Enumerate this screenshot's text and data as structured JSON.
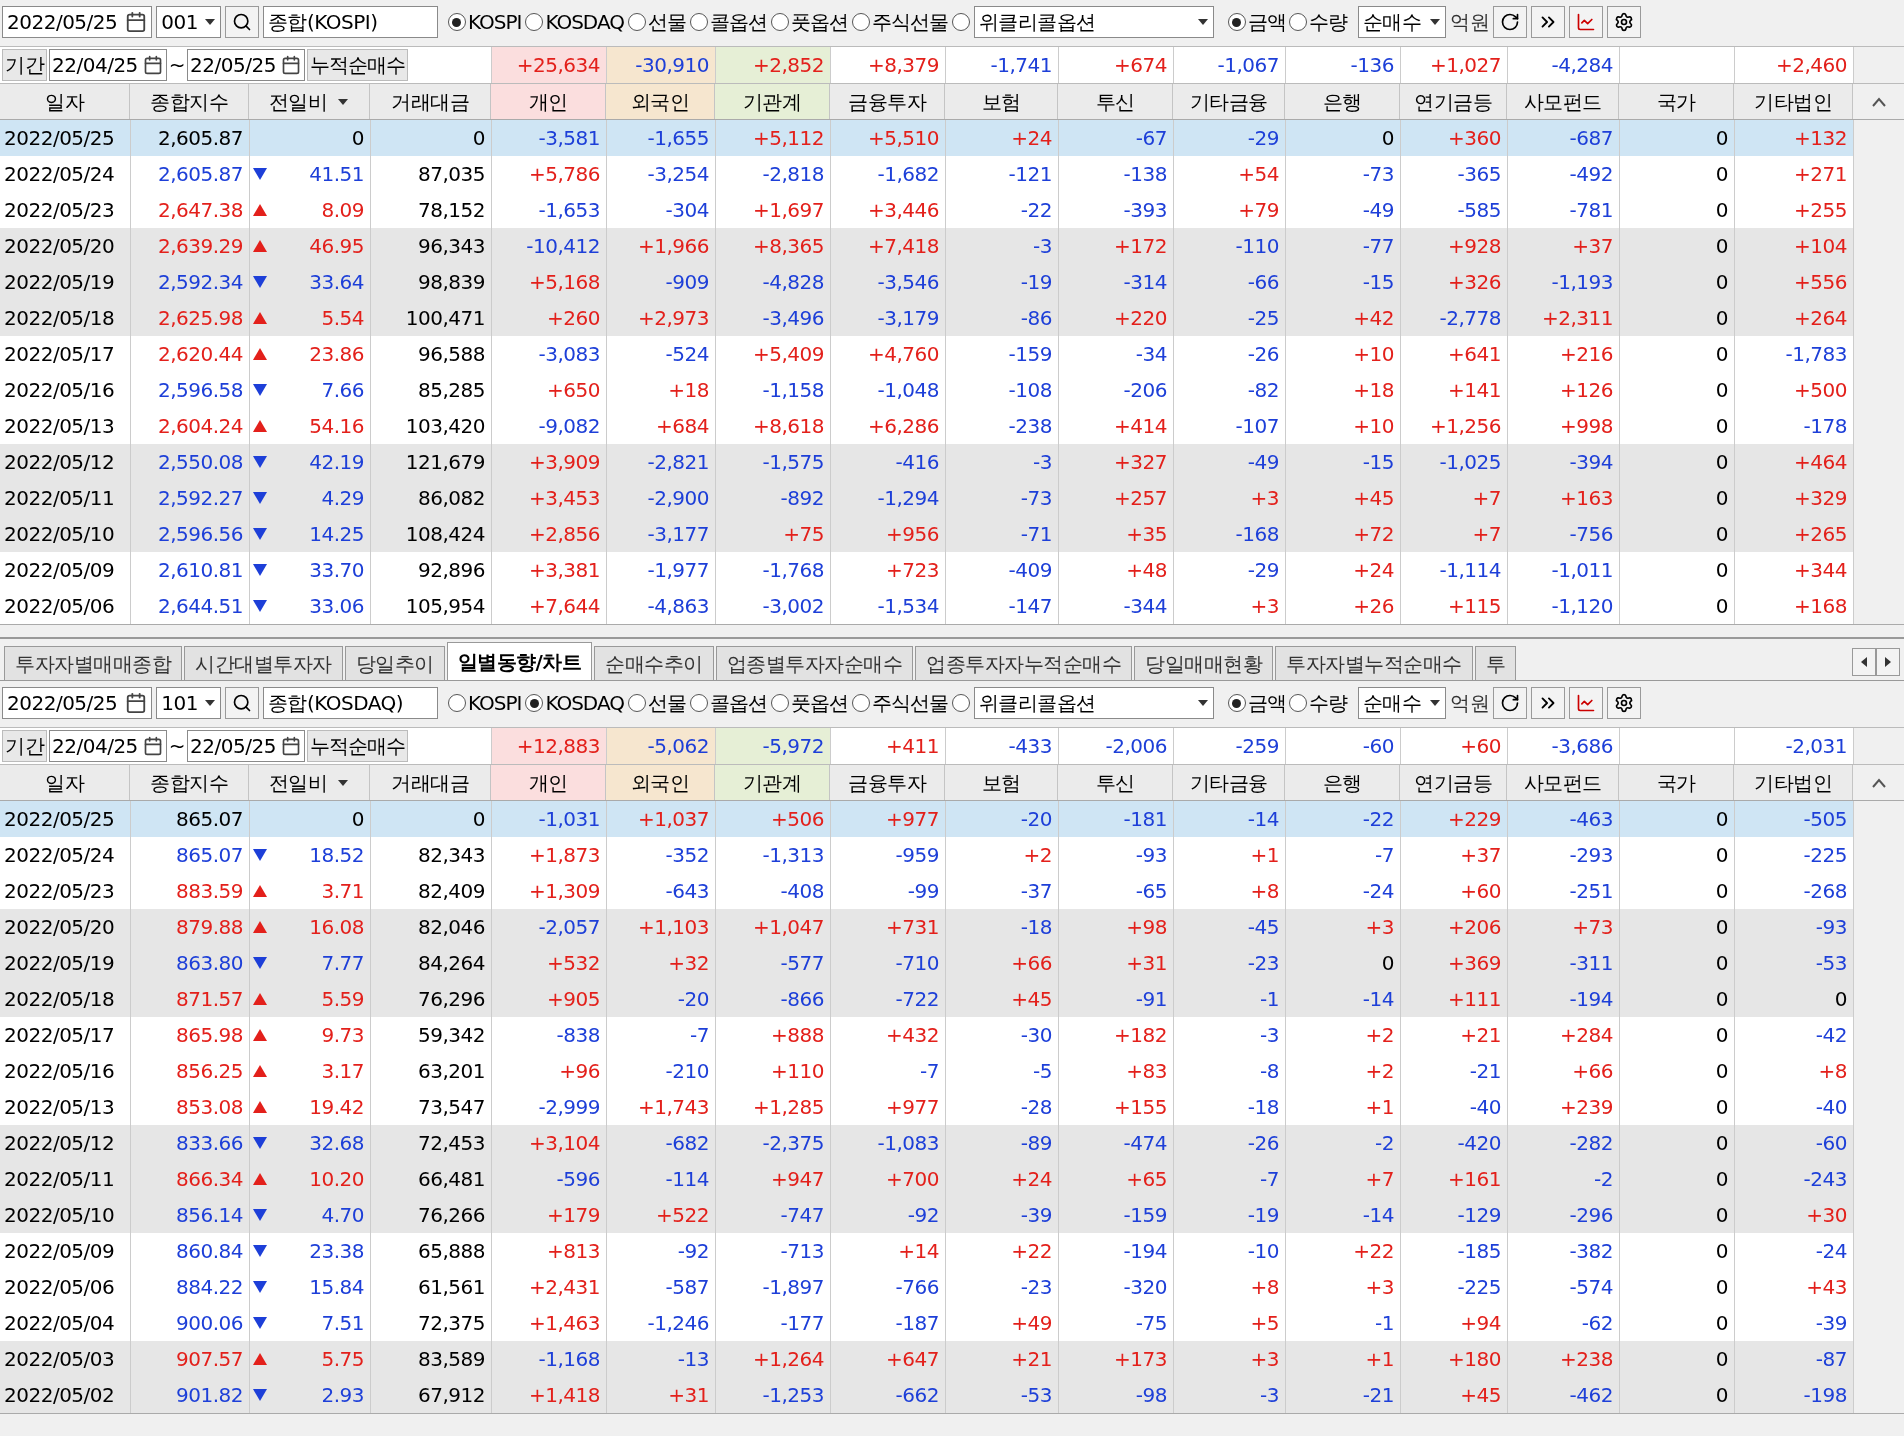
{
  "panels": [
    {
      "toolbar": {
        "date": "2022/05/25",
        "code": "001",
        "name": "종합(KOSPI)",
        "markets": [
          {
            "label": "KOSPI",
            "selected": true,
            "kind": "radio"
          },
          {
            "label": "KOSDAQ",
            "selected": false,
            "kind": "radio"
          },
          {
            "label": "선물",
            "selected": false,
            "kind": "radio"
          },
          {
            "label": "콜옵션",
            "selected": false,
            "kind": "radio"
          },
          {
            "label": "풋옵션",
            "selected": false,
            "kind": "radio"
          },
          {
            "label": "주식선물",
            "selected": false,
            "kind": "radio"
          },
          {
            "label": "위클리콜옵션",
            "selected": false,
            "kind": "dropdown"
          }
        ],
        "units": [
          {
            "label": "금액",
            "selected": true
          },
          {
            "label": "수량",
            "selected": false
          }
        ],
        "mode": "순매수",
        "unit_label": "억원"
      },
      "summary": {
        "label": "기간",
        "from": "22/04/25",
        "sep": "~",
        "to": "22/05/25",
        "title": "누적순매수",
        "values": [
          "+25,634",
          "-30,910",
          "+2,852",
          "+8,379",
          "-1,741",
          "+674",
          "-1,067",
          "-136",
          "+1,027",
          "-4,284",
          "+2,460"
        ]
      },
      "columns": [
        {
          "label": "일자",
          "menu": false
        },
        {
          "label": "종합지수",
          "menu": false
        },
        {
          "label": "전일비",
          "menu": true
        },
        {
          "label": "거래대금",
          "menu": false
        },
        {
          "label": "개인",
          "menu": false
        },
        {
          "label": "외국인",
          "menu": false
        },
        {
          "label": "기관계",
          "menu": false
        },
        {
          "label": "금융투자",
          "menu": false
        },
        {
          "label": "보험",
          "menu": false
        },
        {
          "label": "투신",
          "menu": false
        },
        {
          "label": "기타금융",
          "menu": false
        },
        {
          "label": "은행",
          "menu": false
        },
        {
          "label": "연기금등",
          "menu": false
        },
        {
          "label": "사모펀드",
          "menu": false
        },
        {
          "label": "국가",
          "menu": false
        },
        {
          "label": "기타법인",
          "menu": false
        }
      ],
      "rows": [
        {
          "date": "2022/05/25",
          "index": "2,605.87",
          "kind": "flat",
          "change": "0",
          "volume": "0",
          "values": [
            "-3,581",
            "-1,655",
            "+5,112",
            "+5,510",
            "+24",
            "-67",
            "-29",
            "0",
            "+360",
            "-687",
            "0",
            "+132"
          ],
          "selected": true
        },
        {
          "date": "2022/05/24",
          "index": "2,605.87",
          "kind": "down",
          "change": "41.51",
          "volume": "87,035",
          "values": [
            "+5,786",
            "-3,254",
            "-2,818",
            "-1,682",
            "-121",
            "-138",
            "+54",
            "-73",
            "-365",
            "-492",
            "0",
            "+271"
          ],
          "selected": false
        },
        {
          "date": "2022/05/23",
          "index": "2,647.38",
          "kind": "up",
          "change": "8.09",
          "volume": "78,152",
          "values": [
            "-1,653",
            "-304",
            "+1,697",
            "+3,446",
            "-22",
            "-393",
            "+79",
            "-49",
            "-585",
            "-781",
            "0",
            "+255"
          ],
          "selected": false
        },
        {
          "date": "2022/05/20",
          "index": "2,639.29",
          "kind": "up",
          "change": "46.95",
          "volume": "96,343",
          "values": [
            "-10,412",
            "+1,966",
            "+8,365",
            "+7,418",
            "-3",
            "+172",
            "-110",
            "-77",
            "+928",
            "+37",
            "0",
            "+104"
          ],
          "selected": false
        },
        {
          "date": "2022/05/19",
          "index": "2,592.34",
          "kind": "down",
          "change": "33.64",
          "volume": "98,839",
          "values": [
            "+5,168",
            "-909",
            "-4,828",
            "-3,546",
            "-19",
            "-314",
            "-66",
            "-15",
            "+326",
            "-1,193",
            "0",
            "+556"
          ],
          "selected": false
        },
        {
          "date": "2022/05/18",
          "index": "2,625.98",
          "kind": "up",
          "change": "5.54",
          "volume": "100,471",
          "values": [
            "+260",
            "+2,973",
            "-3,496",
            "-3,179",
            "-86",
            "+220",
            "-25",
            "+42",
            "-2,778",
            "+2,311",
            "0",
            "+264"
          ],
          "selected": false
        },
        {
          "date": "2022/05/17",
          "index": "2,620.44",
          "kind": "up",
          "change": "23.86",
          "volume": "96,588",
          "values": [
            "-3,083",
            "-524",
            "+5,409",
            "+4,760",
            "-159",
            "-34",
            "-26",
            "+10",
            "+641",
            "+216",
            "0",
            "-1,783"
          ],
          "selected": false
        },
        {
          "date": "2022/05/16",
          "index": "2,596.58",
          "kind": "down",
          "change": "7.66",
          "volume": "85,285",
          "values": [
            "+650",
            "+18",
            "-1,158",
            "-1,048",
            "-108",
            "-206",
            "-82",
            "+18",
            "+141",
            "+126",
            "0",
            "+500"
          ],
          "selected": false
        },
        {
          "date": "2022/05/13",
          "index": "2,604.24",
          "kind": "up",
          "change": "54.16",
          "volume": "103,420",
          "values": [
            "-9,082",
            "+684",
            "+8,618",
            "+6,286",
            "-238",
            "+414",
            "-107",
            "+10",
            "+1,256",
            "+998",
            "0",
            "-178"
          ],
          "selected": false
        },
        {
          "date": "2022/05/12",
          "index": "2,550.08",
          "kind": "down",
          "change": "42.19",
          "volume": "121,679",
          "values": [
            "+3,909",
            "-2,821",
            "-1,575",
            "-416",
            "-3",
            "+327",
            "-49",
            "-15",
            "-1,025",
            "-394",
            "0",
            "+464"
          ],
          "selected": false
        },
        {
          "date": "2022/05/11",
          "index": "2,592.27",
          "kind": "down",
          "change": "4.29",
          "volume": "86,082",
          "values": [
            "+3,453",
            "-2,900",
            "-892",
            "-1,294",
            "-73",
            "+257",
            "+3",
            "+45",
            "+7",
            "+163",
            "0",
            "+329"
          ],
          "selected": false
        },
        {
          "date": "2022/05/10",
          "index": "2,596.56",
          "kind": "down",
          "change": "14.25",
          "volume": "108,424",
          "values": [
            "+2,856",
            "-3,177",
            "+75",
            "+956",
            "-71",
            "+35",
            "-168",
            "+72",
            "+7",
            "-756",
            "0",
            "+265"
          ],
          "selected": false
        },
        {
          "date": "2022/05/09",
          "index": "2,610.81",
          "kind": "down",
          "change": "33.70",
          "volume": "92,896",
          "values": [
            "+3,381",
            "-1,977",
            "-1,768",
            "+723",
            "-409",
            "+48",
            "-29",
            "+24",
            "-1,114",
            "-1,011",
            "0",
            "+344"
          ],
          "selected": false
        },
        {
          "date": "2022/05/06",
          "index": "2,644.51",
          "kind": "down",
          "change": "33.06",
          "volume": "105,954",
          "values": [
            "+7,644",
            "-4,863",
            "-3,002",
            "-1,534",
            "-147",
            "-344",
            "+3",
            "+26",
            "+115",
            "-1,120",
            "0",
            "+168"
          ],
          "selected": false
        }
      ]
    },
    {
      "tabs": [
        {
          "label": "투자자별매매종합",
          "selected": false
        },
        {
          "label": "시간대별투자자",
          "selected": false
        },
        {
          "label": "당일추이",
          "selected": false
        },
        {
          "label": "일별동향/차트",
          "selected": true
        },
        {
          "label": "순매수추이",
          "selected": false
        },
        {
          "label": "업종별투자자순매수",
          "selected": false
        },
        {
          "label": "업종투자자누적순매수",
          "selected": false
        },
        {
          "label": "당일매매현황",
          "selected": false
        },
        {
          "label": "투자자별누적순매수",
          "selected": false
        },
        {
          "label": "투",
          "selected": false
        }
      ],
      "toolbar": {
        "date": "2022/05/25",
        "code": "101",
        "name": "종합(KOSDAQ)",
        "markets": [
          {
            "label": "KOSPI",
            "selected": false,
            "kind": "radio"
          },
          {
            "label": "KOSDAQ",
            "selected": true,
            "kind": "radio"
          },
          {
            "label": "선물",
            "selected": false,
            "kind": "radio"
          },
          {
            "label": "콜옵션",
            "selected": false,
            "kind": "radio"
          },
          {
            "label": "풋옵션",
            "selected": false,
            "kind": "radio"
          },
          {
            "label": "주식선물",
            "selected": false,
            "kind": "radio"
          },
          {
            "label": "위클리콜옵션",
            "selected": false,
            "kind": "dropdown"
          }
        ],
        "units": [
          {
            "label": "금액",
            "selected": true
          },
          {
            "label": "수량",
            "selected": false
          }
        ],
        "mode": "순매수",
        "unit_label": "억원"
      },
      "summary": {
        "label": "기간",
        "from": "22/04/25",
        "sep": "~",
        "to": "22/05/25",
        "title": "누적순매수",
        "values": [
          "+12,883",
          "-5,062",
          "-5,972",
          "+411",
          "-433",
          "-2,006",
          "-259",
          "-60",
          "+60",
          "-3,686",
          "-2,031"
        ]
      },
      "columns": [
        {
          "label": "일자",
          "menu": false
        },
        {
          "label": "종합지수",
          "menu": false
        },
        {
          "label": "전일비",
          "menu": true
        },
        {
          "label": "거래대금",
          "menu": false
        },
        {
          "label": "개인",
          "menu": false
        },
        {
          "label": "외국인",
          "menu": false
        },
        {
          "label": "기관계",
          "menu": false
        },
        {
          "label": "금융투자",
          "menu": false
        },
        {
          "label": "보험",
          "menu": false
        },
        {
          "label": "투신",
          "menu": false
        },
        {
          "label": "기타금융",
          "menu": false
        },
        {
          "label": "은행",
          "menu": false
        },
        {
          "label": "연기금등",
          "menu": false
        },
        {
          "label": "사모펀드",
          "menu": false
        },
        {
          "label": "국가",
          "menu": false
        },
        {
          "label": "기타법인",
          "menu": false
        }
      ],
      "rows": [
        {
          "date": "2022/05/25",
          "index": "865.07",
          "kind": "flat",
          "change": "0",
          "volume": "0",
          "values": [
            "-1,031",
            "+1,037",
            "+506",
            "+977",
            "-20",
            "-181",
            "-14",
            "-22",
            "+229",
            "-463",
            "0",
            "-505"
          ],
          "selected": true
        },
        {
          "date": "2022/05/24",
          "index": "865.07",
          "kind": "down",
          "change": "18.52",
          "volume": "82,343",
          "values": [
            "+1,873",
            "-352",
            "-1,313",
            "-959",
            "+2",
            "-93",
            "+1",
            "-7",
            "+37",
            "-293",
            "0",
            "-225"
          ],
          "selected": false
        },
        {
          "date": "2022/05/23",
          "index": "883.59",
          "kind": "up",
          "change": "3.71",
          "volume": "82,409",
          "values": [
            "+1,309",
            "-643",
            "-408",
            "-99",
            "-37",
            "-65",
            "+8",
            "-24",
            "+60",
            "-251",
            "0",
            "-268"
          ],
          "selected": false
        },
        {
          "date": "2022/05/20",
          "index": "879.88",
          "kind": "up",
          "change": "16.08",
          "volume": "82,046",
          "values": [
            "-2,057",
            "+1,103",
            "+1,047",
            "+731",
            "-18",
            "+98",
            "-45",
            "+3",
            "+206",
            "+73",
            "0",
            "-93"
          ],
          "selected": false
        },
        {
          "date": "2022/05/19",
          "index": "863.80",
          "kind": "down",
          "change": "7.77",
          "volume": "84,264",
          "values": [
            "+532",
            "+32",
            "-577",
            "-710",
            "+66",
            "+31",
            "-23",
            "0",
            "+369",
            "-311",
            "0",
            "-53"
          ],
          "selected": false
        },
        {
          "date": "2022/05/18",
          "index": "871.57",
          "kind": "up",
          "change": "5.59",
          "volume": "76,296",
          "values": [
            "+905",
            "-20",
            "-866",
            "-722",
            "+45",
            "-91",
            "-1",
            "-14",
            "+111",
            "-194",
            "0",
            "0"
          ],
          "selected": false
        },
        {
          "date": "2022/05/17",
          "index": "865.98",
          "kind": "up",
          "change": "9.73",
          "volume": "59,342",
          "values": [
            "-838",
            "-7",
            "+888",
            "+432",
            "-30",
            "+182",
            "-3",
            "+2",
            "+21",
            "+284",
            "0",
            "-42"
          ],
          "selected": false
        },
        {
          "date": "2022/05/16",
          "index": "856.25",
          "kind": "up",
          "change": "3.17",
          "volume": "63,201",
          "values": [
            "+96",
            "-210",
            "+110",
            "-7",
            "-5",
            "+83",
            "-8",
            "+2",
            "-21",
            "+66",
            "0",
            "+8"
          ],
          "selected": false
        },
        {
          "date": "2022/05/13",
          "index": "853.08",
          "kind": "up",
          "change": "19.42",
          "volume": "73,547",
          "values": [
            "-2,999",
            "+1,743",
            "+1,285",
            "+977",
            "-28",
            "+155",
            "-18",
            "+1",
            "-40",
            "+239",
            "0",
            "-40"
          ],
          "selected": false
        },
        {
          "date": "2022/05/12",
          "index": "833.66",
          "kind": "down",
          "change": "32.68",
          "volume": "72,453",
          "values": [
            "+3,104",
            "-682",
            "-2,375",
            "-1,083",
            "-89",
            "-474",
            "-26",
            "-2",
            "-420",
            "-282",
            "0",
            "-60"
          ],
          "selected": false
        },
        {
          "date": "2022/05/11",
          "index": "866.34",
          "kind": "up",
          "change": "10.20",
          "volume": "66,481",
          "values": [
            "-596",
            "-114",
            "+947",
            "+700",
            "+24",
            "+65",
            "-7",
            "+7",
            "+161",
            "-2",
            "0",
            "-243"
          ],
          "selected": false
        },
        {
          "date": "2022/05/10",
          "index": "856.14",
          "kind": "down",
          "change": "4.70",
          "volume": "76,266",
          "values": [
            "+179",
            "+522",
            "-747",
            "-92",
            "-39",
            "-159",
            "-19",
            "-14",
            "-129",
            "-296",
            "0",
            "+30"
          ],
          "selected": false
        },
        {
          "date": "2022/05/09",
          "index": "860.84",
          "kind": "down",
          "change": "23.38",
          "volume": "65,888",
          "values": [
            "+813",
            "-92",
            "-713",
            "+14",
            "+22",
            "-194",
            "-10",
            "+22",
            "-185",
            "-382",
            "0",
            "-24"
          ],
          "selected": false
        },
        {
          "date": "2022/05/06",
          "index": "884.22",
          "kind": "down",
          "change": "15.84",
          "volume": "61,561",
          "values": [
            "+2,431",
            "-587",
            "-1,897",
            "-766",
            "-23",
            "-320",
            "+8",
            "+3",
            "-225",
            "-574",
            "0",
            "+43"
          ],
          "selected": false
        },
        {
          "date": "2022/05/04",
          "index": "900.06",
          "kind": "down",
          "change": "7.51",
          "volume": "72,375",
          "values": [
            "+1,463",
            "-1,246",
            "-177",
            "-187",
            "+49",
            "-75",
            "+5",
            "-1",
            "+94",
            "-62",
            "0",
            "-39"
          ],
          "selected": false
        },
        {
          "date": "2022/05/03",
          "index": "907.57",
          "kind": "up",
          "change": "5.75",
          "volume": "83,589",
          "values": [
            "-1,168",
            "-13",
            "+1,264",
            "+647",
            "+21",
            "+173",
            "+3",
            "+1",
            "+180",
            "+238",
            "0",
            "-87"
          ],
          "selected": false
        },
        {
          "date": "2022/05/02",
          "index": "901.82",
          "kind": "down",
          "change": "2.93",
          "volume": "67,912",
          "values": [
            "+1,418",
            "+31",
            "-1,253",
            "-662",
            "-53",
            "-98",
            "-3",
            "-21",
            "+45",
            "-462",
            "0",
            "-198"
          ],
          "selected": false
        }
      ]
    }
  ]
}
